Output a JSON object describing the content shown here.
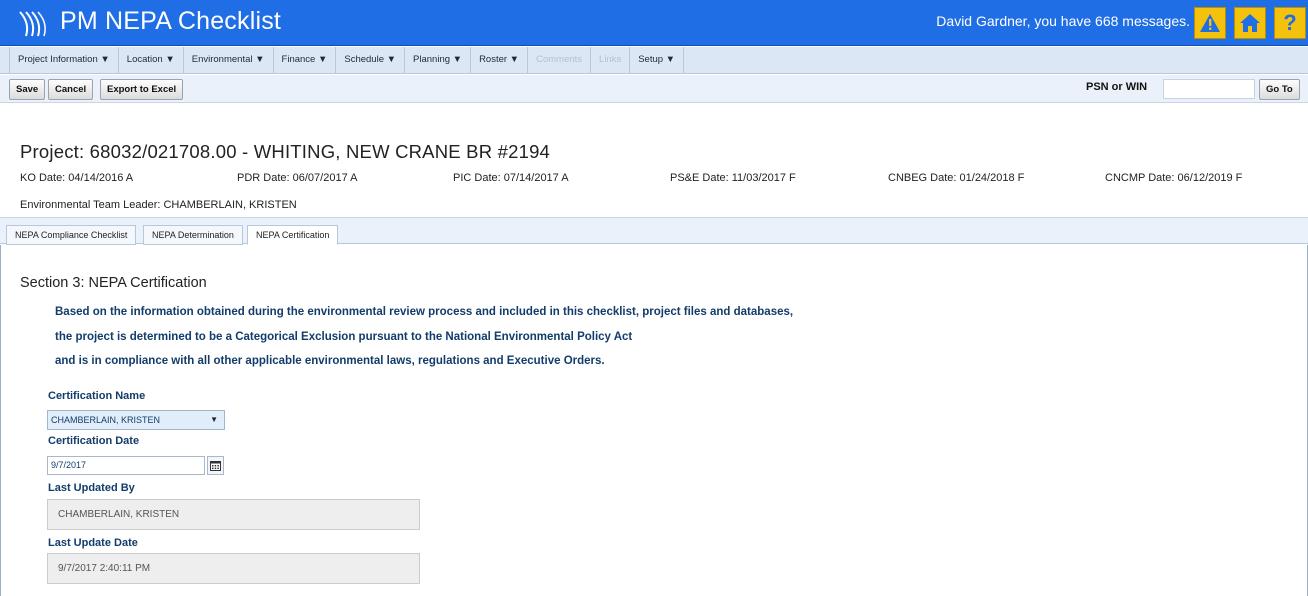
{
  "header": {
    "title": "PM NEPA Checklist",
    "messages": "David Gardner, you have 668 messages.",
    "icons": [
      "alert-icon",
      "home-icon",
      "help-icon"
    ],
    "help_glyph": "?",
    "colors": {
      "bar": "#1f6ee5",
      "button": "#f4c20d"
    }
  },
  "menu": {
    "items": [
      {
        "label": "Project Information ▼",
        "enabled": true
      },
      {
        "label": "Location ▼",
        "enabled": true
      },
      {
        "label": "Environmental ▼",
        "enabled": true
      },
      {
        "label": "Finance ▼",
        "enabled": true
      },
      {
        "label": "Schedule ▼",
        "enabled": true
      },
      {
        "label": "Planning ▼",
        "enabled": true
      },
      {
        "label": "Roster ▼",
        "enabled": true
      },
      {
        "label": "Comments",
        "enabled": false
      },
      {
        "label": "Links",
        "enabled": false
      },
      {
        "label": "Setup ▼",
        "enabled": true
      }
    ]
  },
  "toolbar": {
    "save": "Save",
    "cancel": "Cancel",
    "export": "Export to Excel",
    "psn_label": "PSN or WIN",
    "psn_value": "",
    "goto": "Go To"
  },
  "project": {
    "title": "Project: 68032/021708.00 - WHITING, NEW CRANE BR #2194",
    "dates": {
      "ko": "KO Date: 04/14/2016 A",
      "pdr": "PDR Date: 06/07/2017 A",
      "pic": "PIC Date: 07/14/2017 A",
      "pse": "PS&E Date: 11/03/2017 F",
      "cnbeg": "CNBEG Date: 01/24/2018 F",
      "cncmp": "CNCMP Date: 06/12/2019 F"
    },
    "team_leader": "Environmental Team Leader: CHAMBERLAIN, KRISTEN"
  },
  "tabs": [
    {
      "label": "NEPA Compliance Checklist",
      "active": false
    },
    {
      "label": "NEPA Determination",
      "active": false
    },
    {
      "label": "NEPA Certification",
      "active": true
    }
  ],
  "section": {
    "title": "Section 3: NEPA Certification",
    "statement": [
      "Based on the information obtained during the environmental review process and included in this checklist, project files and databases,",
      "the project is determined to be a Categorical Exclusion pursuant to the National Environmental Policy Act",
      "and is in compliance with all other applicable environmental laws, regulations and Executive Orders."
    ]
  },
  "form": {
    "cert_name_label": "Certification Name",
    "cert_name_value": "CHAMBERLAIN, KRISTEN",
    "cert_date_label": "Certification Date",
    "cert_date_value": "9/7/2017",
    "updated_by_label": "Last Updated By",
    "updated_by_value": "CHAMBERLAIN, KRISTEN",
    "update_date_label": "Last Update Date",
    "update_date_value": "9/7/2017 2:40:11 PM"
  }
}
